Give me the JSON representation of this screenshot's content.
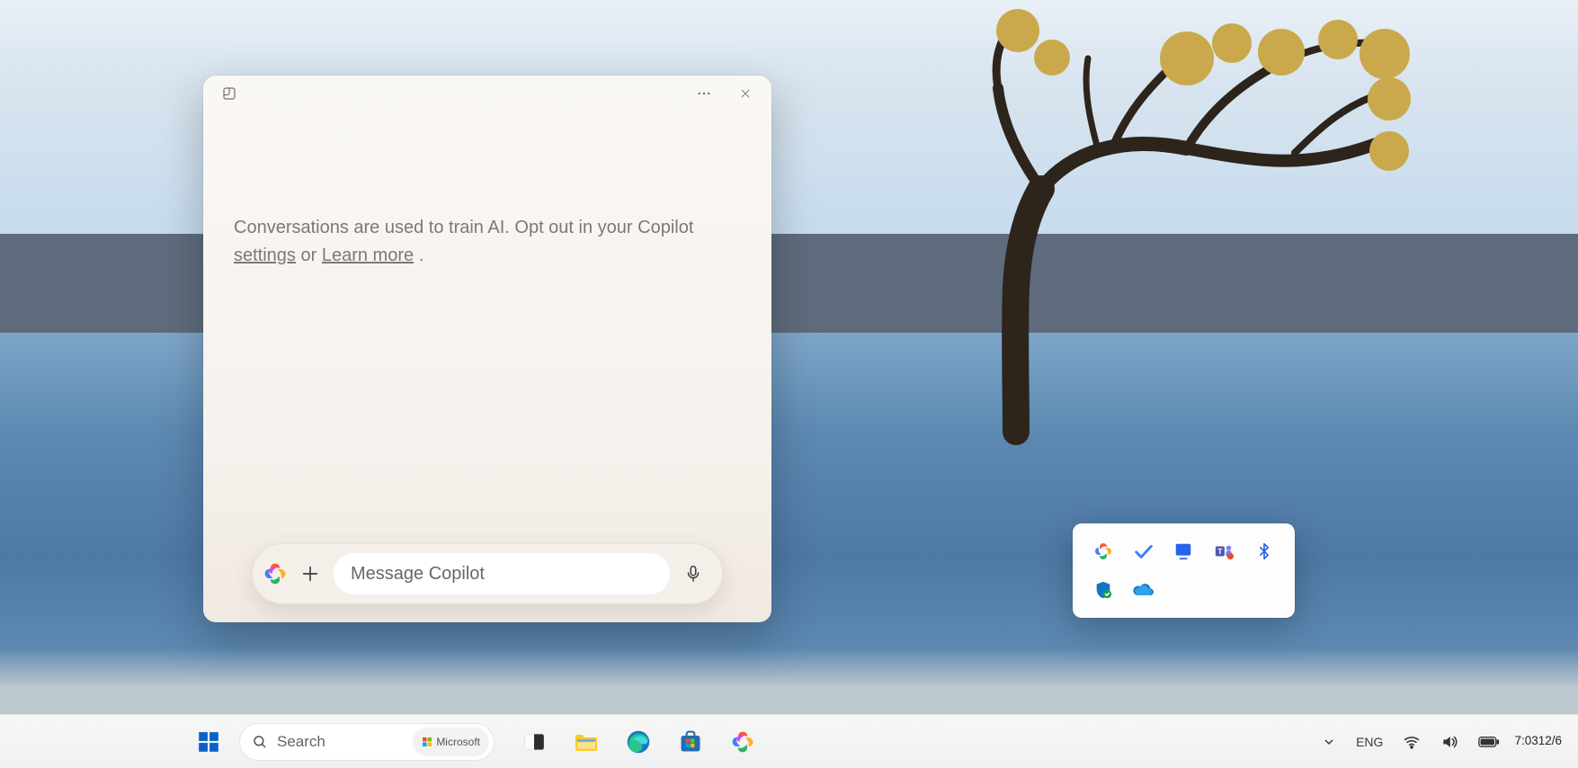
{
  "copilot": {
    "notice_prefix": "Conversations are used to train AI. Opt out in your Copilot ",
    "settings_link": "settings",
    "notice_mid": " or ",
    "learn_more_link": "Learn more",
    "notice_suffix": ".",
    "input_placeholder": "Message Copilot",
    "icons": {
      "expand": "expand-icon",
      "more": "more-icon",
      "close": "close-icon",
      "plus": "plus-icon",
      "mic": "microphone-icon",
      "logo": "copilot-icon"
    }
  },
  "tray_flyout": {
    "items": [
      "copilot-icon",
      "todo-icon",
      "your-phone-icon",
      "teams-icon",
      "bluetooth-icon",
      "windows-security-icon",
      "onedrive-icon"
    ]
  },
  "taskbar": {
    "search_placeholder": "Search",
    "search_pill": "Microsoft",
    "apps": [
      "task-view-icon",
      "file-explorer-icon",
      "edge-icon",
      "microsoft-store-icon",
      "copilot-icon"
    ],
    "system": {
      "chevron": "chevron-up-icon",
      "language": "ENG",
      "wifi": "wifi-icon",
      "volume": "volume-icon",
      "battery": "battery-icon",
      "time": "7:03",
      "date": "12/6"
    }
  }
}
